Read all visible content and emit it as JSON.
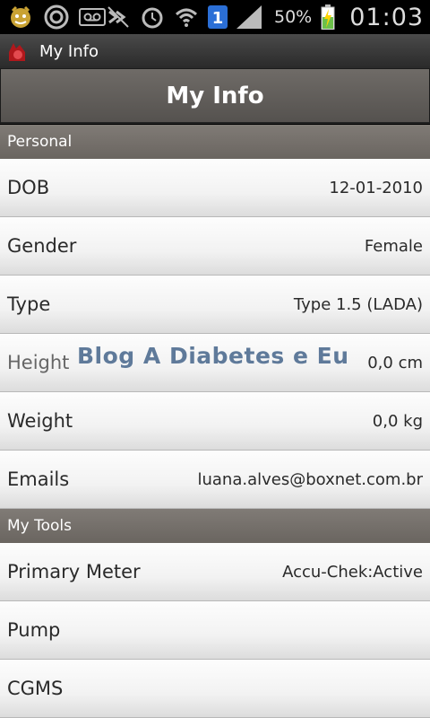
{
  "status_bar": {
    "battery_pct": "50%",
    "time": "01:03",
    "notification_count": "1"
  },
  "app_bar": {
    "title": "My Info"
  },
  "header": {
    "title": "My Info"
  },
  "sections": {
    "personal": "Personal",
    "tools": "My Tools"
  },
  "personal_rows": [
    {
      "label": "DOB",
      "value": "12-01-2010"
    },
    {
      "label": "Gender",
      "value": "Female"
    },
    {
      "label": "Type",
      "value": "Type 1.5 (LADA)"
    },
    {
      "label": "Height",
      "value": "0,0 cm"
    },
    {
      "label": "Weight",
      "value": "0,0 kg"
    },
    {
      "label": "Emails",
      "value": "luana.alves@boxnet.com.br"
    }
  ],
  "tools_rows": [
    {
      "label": "Primary Meter",
      "value": "Accu-Chek:Active"
    },
    {
      "label": "Pump",
      "value": ""
    },
    {
      "label": "CGMS",
      "value": ""
    }
  ],
  "watermark": "Blog A Diabetes e Eu"
}
